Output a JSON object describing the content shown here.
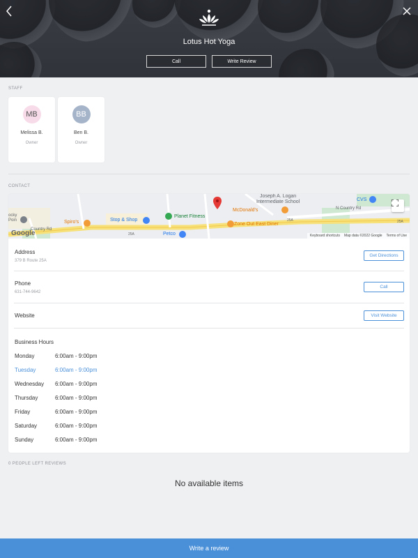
{
  "header": {
    "title": "Lotus Hot Yoga",
    "call_label": "Call",
    "review_label": "Write Review",
    "back_icon": "chevron-left-icon",
    "close_icon": "close-icon",
    "logo_icon": "lotus-icon"
  },
  "staff": {
    "section_label": "STAFF",
    "members": [
      {
        "initials": "MB",
        "name": "Melissa B.",
        "role": "Owner",
        "avatar_color": "#f7dbe8"
      },
      {
        "initials": "BB",
        "name": "Ben B.",
        "role": "Owner",
        "avatar_color": "#a6b4c9"
      }
    ]
  },
  "contact": {
    "section_label": "CONTACT",
    "map": {
      "labels": {
        "school": "Joseph A. Logan\nIntermediate School",
        "mcdonalds": "McDonald's",
        "cvs": "CVS",
        "n_country": "N Country Rd",
        "stop_shop": "Stop & Shop",
        "planet": "Planet Fitness",
        "spiros": "Spiro's",
        "zone": "Zone Out East Diner",
        "petco": "Petco",
        "r25a_1": "25A",
        "r25a_2": "25A",
        "r25a_3": "25A",
        "country_rd": "Country Rd",
        "rocky": "ocky\nPoin"
      },
      "footer_keyboard": "Keyboard shortcuts",
      "footer_data": "Map data ©2022 Google",
      "footer_terms": "Terms of Use",
      "google": "Google",
      "fullscreen_icon": "fullscreen-icon",
      "pin_icon": "map-pin-icon"
    },
    "address": {
      "label": "Address",
      "value": "379 B Route 25A",
      "button": "Get Directions"
    },
    "phone": {
      "label": "Phone",
      "value": "631-744-9642",
      "button": "Call"
    },
    "website": {
      "label": "Website",
      "button": "Visit Website"
    },
    "hours": {
      "title": "Business Hours",
      "days": [
        {
          "day": "Monday",
          "time": "6:00am - 9:00pm",
          "today": false
        },
        {
          "day": "Tuesday",
          "time": "6:00am - 9:00pm",
          "today": true
        },
        {
          "day": "Wednesday",
          "time": "6:00am - 9:00pm",
          "today": false
        },
        {
          "day": "Thursday",
          "time": "6:00am - 9:00pm",
          "today": false
        },
        {
          "day": "Friday",
          "time": "6:00am - 9:00pm",
          "today": false
        },
        {
          "day": "Saturday",
          "time": "6:00am - 9:00pm",
          "today": false
        },
        {
          "day": "Sunday",
          "time": "6:00am - 9:00pm",
          "today": false
        }
      ]
    }
  },
  "reviews": {
    "section_label": "0 PEOPLE LEFT REVIEWS",
    "empty_text": "No available items",
    "write_button": "Write a review"
  },
  "colors": {
    "accent": "#4a90d9",
    "background": "#eff0f2"
  }
}
